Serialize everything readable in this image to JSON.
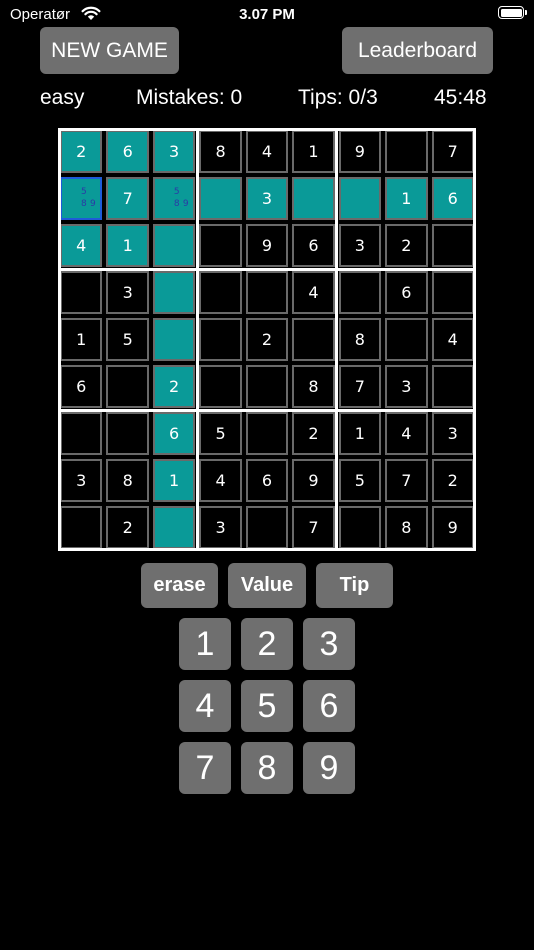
{
  "status_bar": {
    "carrier": "Operatør",
    "time": "3.07 PM"
  },
  "header": {
    "new_game": "NEW GAME",
    "leaderboard": "Leaderboard"
  },
  "info": {
    "difficulty": "easy",
    "mistakes": "Mistakes: 0",
    "tips": "Tips: 0/3",
    "timer": "45:48"
  },
  "board": {
    "grid": [
      [
        "2",
        "6",
        "3",
        "8",
        "4",
        "1",
        "9",
        "",
        "7"
      ],
      [
        "",
        "7",
        "",
        "",
        "3",
        "",
        "",
        "1",
        "6"
      ],
      [
        "4",
        "1",
        "",
        "",
        "9",
        "6",
        "3",
        "2",
        ""
      ],
      [
        "",
        "3",
        "",
        "",
        "",
        "4",
        "",
        "6",
        ""
      ],
      [
        "1",
        "5",
        "",
        "",
        "2",
        "",
        "8",
        "",
        "4"
      ],
      [
        "6",
        "",
        "2",
        "",
        "",
        "8",
        "7",
        "3",
        ""
      ],
      [
        "",
        "",
        "6",
        "5",
        "",
        "2",
        "1",
        "4",
        "3"
      ],
      [
        "3",
        "8",
        "1",
        "4",
        "6",
        "9",
        "5",
        "7",
        "2"
      ],
      [
        "",
        "2",
        "",
        "3",
        "",
        "7",
        "",
        "8",
        "9"
      ]
    ],
    "highlighted": [
      [
        0,
        0
      ],
      [
        0,
        1
      ],
      [
        0,
        2
      ],
      [
        1,
        0
      ],
      [
        1,
        1
      ],
      [
        1,
        2
      ],
      [
        1,
        3
      ],
      [
        1,
        4
      ],
      [
        1,
        5
      ],
      [
        1,
        6
      ],
      [
        1,
        7
      ],
      [
        1,
        8
      ],
      [
        2,
        0
      ],
      [
        2,
        1
      ],
      [
        2,
        2
      ],
      [
        3,
        2
      ],
      [
        4,
        2
      ],
      [
        5,
        2
      ],
      [
        6,
        2
      ],
      [
        7,
        2
      ],
      [
        8,
        2
      ]
    ],
    "selected": [
      1,
      0
    ],
    "notes": {
      "1,0": [
        "5",
        "8",
        "9"
      ],
      "1,2": [
        "5",
        "8",
        "9"
      ]
    }
  },
  "actions": {
    "erase": "erase",
    "value": "Value",
    "tip": "Tip"
  },
  "keypad": [
    "1",
    "2",
    "3",
    "4",
    "5",
    "6",
    "7",
    "8",
    "9"
  ],
  "colors": {
    "highlight": "#0a9a98",
    "button": "#6f6f6f",
    "note": "#2b3aa6",
    "selected_border": "#1e5bd8"
  }
}
